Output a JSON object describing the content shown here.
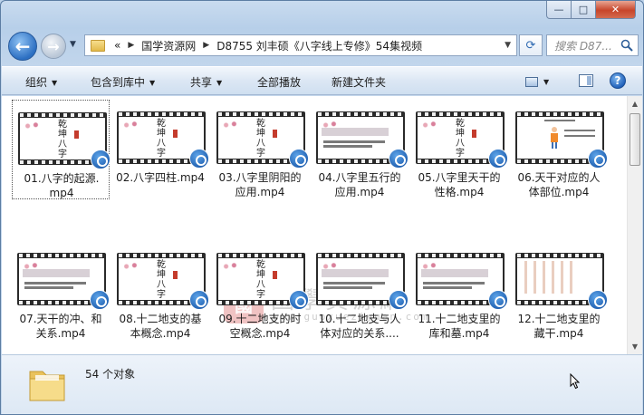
{
  "window": {
    "caption_minimize": "—",
    "caption_maximize": "□",
    "caption_close": "✕"
  },
  "address": {
    "prefix": "«",
    "crumbs": [
      "国学资源网",
      "D8755 刘丰硕《八字线上专修》54集视频"
    ],
    "separator": "▶"
  },
  "search": {
    "placeholder": "搜索 D87..."
  },
  "toolbar": {
    "organize": "组织",
    "include_in_library": "包含到库中",
    "share": "共享",
    "play_all": "全部播放",
    "new_folder": "新建文件夹"
  },
  "thumb_text": {
    "qiankun": "乾坤八字"
  },
  "files": [
    {
      "name": "01.八字的起源.",
      "ext": "mp4",
      "selected": true,
      "thumb": "qiankun"
    },
    {
      "name": "02.八字四柱.mp4",
      "ext": "",
      "selected": false,
      "thumb": "qiankun"
    },
    {
      "name": "03.八字里阴阳的",
      "ext": "应用.mp4",
      "selected": false,
      "thumb": "qiankun"
    },
    {
      "name": "04.八字里五行的",
      "ext": "应用.mp4",
      "selected": false,
      "thumb": "slide"
    },
    {
      "name": "05.八字里天干的",
      "ext": "性格.mp4",
      "selected": false,
      "thumb": "qiankun"
    },
    {
      "name": "06.天干对应的人",
      "ext": "体部位.mp4",
      "selected": false,
      "thumb": "figure"
    },
    {
      "name": "07.天干的冲、和",
      "ext": "关系.mp4",
      "selected": false,
      "thumb": "slide"
    },
    {
      "name": "08.十二地支的基",
      "ext": "本概念.mp4",
      "selected": false,
      "thumb": "qiankun"
    },
    {
      "name": "09.十二地支的时",
      "ext": "空概念.mp4",
      "selected": false,
      "thumb": "qiankun"
    },
    {
      "name": "10.十二地支与人",
      "ext": "体对应的关系....",
      "selected": false,
      "thumb": "slide"
    },
    {
      "name": "11.十二地支里的",
      "ext": "库和墓.mp4",
      "selected": false,
      "thumb": "slide"
    },
    {
      "name": "12.十二地支里的",
      "ext": "藏干.mp4",
      "selected": false,
      "thumb": "grid"
    }
  ],
  "watermark": {
    "seal": "國",
    "name": "國學資源網",
    "url": "www.guoxueziyuan.com"
  },
  "status": {
    "object_count": "54 个对象"
  },
  "colors": {
    "accent": "#2c6fc2",
    "close": "#c7452a",
    "selection_border": "#555555"
  }
}
